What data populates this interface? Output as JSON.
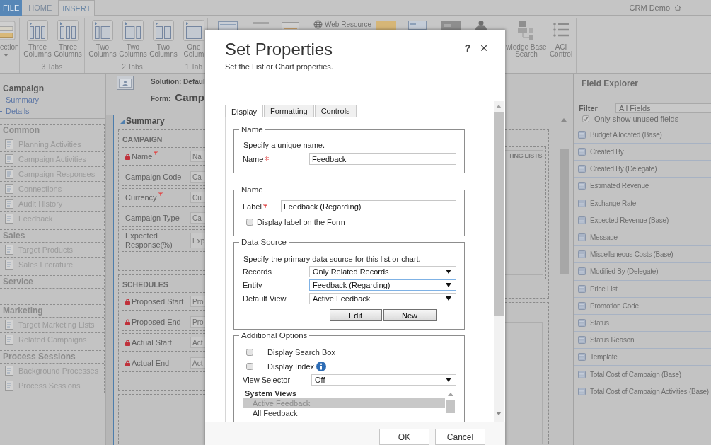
{
  "ribbon_tabs": [
    {
      "label": "FILE",
      "kind": "file",
      "selected": false
    },
    {
      "label": "HOME",
      "kind": "tab",
      "selected": false
    },
    {
      "label": "INSERT",
      "kind": "tab",
      "selected": true
    }
  ],
  "user_name": "CRM Demo",
  "ribbon": {
    "groups": [
      {
        "buttons": [
          {
            "kind": "section",
            "label": "ection"
          }
        ]
      },
      {
        "label": "3 Tabs",
        "buttons": [
          {
            "kind": "three-columns",
            "label": "Three Columns"
          },
          {
            "kind": "three-columns",
            "label": "Three Columns"
          }
        ]
      },
      {
        "label": "2 Tabs",
        "buttons": [
          {
            "kind": "narrow-wide",
            "label": "Two Columns"
          },
          {
            "kind": "wide-narrow",
            "label": "Two Columns"
          },
          {
            "kind": "two-equal",
            "label": "Two Columns"
          }
        ]
      },
      {
        "label": "1 Tab",
        "buttons": [
          {
            "kind": "one-column",
            "label": "One Colum"
          }
        ]
      },
      {
        "buttons": [
          {
            "kind": "window"
          },
          {
            "kind": "bar"
          },
          {
            "kind": "frame"
          },
          {
            "kind": "web-resource",
            "label": "Web Resource"
          },
          {
            "kind": "orange-tile"
          },
          {
            "kind": "blue-window"
          },
          {
            "kind": "dark-tile"
          },
          {
            "kind": "person"
          },
          {
            "kind": "knowledge-base",
            "label": "wledge Base Search"
          },
          {
            "kind": "list",
            "label": "ACI Control"
          }
        ]
      }
    ]
  },
  "left_nav": {
    "title": "Campaign",
    "links": [
      "Summary",
      "Details"
    ],
    "groups": [
      {
        "title": "Common",
        "items": [
          "Planning Activities",
          "Campaign Activities",
          "Campaign Responses",
          "Connections",
          "Audit History",
          "Feedback"
        ]
      },
      {
        "title": "Sales",
        "items": [
          "Target Products",
          "Sales Literature"
        ]
      },
      {
        "title": "Service"
      },
      {
        "title": "Marketing",
        "items": [
          "Target Marketing Lists",
          "Related Campaigns"
        ]
      },
      {
        "title": "Process Sessions",
        "items": [
          "Background Processes",
          "Process Sessions"
        ]
      }
    ]
  },
  "form": {
    "solution": "Solution: Defaul",
    "form_label": "Form:",
    "form_name": "Camp",
    "tab": {
      "title": "Summary",
      "expanded": true
    },
    "sections": [
      {
        "title": "CAMPAIGN",
        "fields": [
          {
            "label": "Name",
            "locked": true,
            "required": true,
            "placeholder": "Na"
          },
          {
            "label": "Campaign Code",
            "locked": false,
            "required": false,
            "placeholder": "Ca"
          },
          {
            "label": "Currency",
            "locked": false,
            "required": true,
            "placeholder": "Cu"
          },
          {
            "label": "Campaign Type",
            "locked": false,
            "required": false,
            "placeholder": "Ca"
          },
          {
            "label": "Expected Response(%)",
            "locked": false,
            "required": false,
            "placeholder": "Exp"
          }
        ]
      },
      {
        "title": "SCHEDULES",
        "fields": [
          {
            "label": "Proposed Start",
            "locked": true,
            "required": false,
            "placeholder": "Pro"
          },
          {
            "label": "Proposed End",
            "locked": true,
            "required": false,
            "placeholder": "Pro"
          },
          {
            "label": "Actual Start",
            "locked": true,
            "required": false,
            "placeholder": "Act"
          },
          {
            "label": "Actual End",
            "locked": true,
            "required": false,
            "placeholder": "Act"
          }
        ]
      }
    ],
    "side_section": {
      "title": "TING LISTS"
    }
  },
  "field_explorer": {
    "title": "Field Explorer",
    "filter_label": "Filter",
    "filter_value": "All Fields",
    "unused_only": {
      "label": "Only show unused fields",
      "checked": true
    },
    "fields": [
      "Budget Allocated (Base)",
      "Created By",
      "Created By (Delegate)",
      "Estimated Revenue",
      "Exchange Rate",
      "Expected Revenue (Base)",
      "Message",
      "Miscellaneous Costs (Base)",
      "Modified By (Delegate)",
      "Price List",
      "Promotion Code",
      "Status",
      "Status Reason",
      "Template",
      "Total Cost of Campaign (Base)",
      "Total Cost of Campaign Activities (Base)"
    ]
  },
  "dialog": {
    "title": "Set Properties",
    "help": "?",
    "close": "×",
    "subtitle": "Set the List or Chart properties.",
    "tabs": [
      {
        "label": "Display",
        "selected": true
      },
      {
        "label": "Formatting",
        "selected": false
      },
      {
        "label": "Controls",
        "selected": false
      }
    ],
    "sections": [
      {
        "legend": "Name",
        "description": "Specify a unique name.",
        "rows": [
          {
            "kind": "text",
            "label": "Name",
            "required": true,
            "value": "Feedback"
          }
        ]
      },
      {
        "legend": "Name",
        "rows": [
          {
            "kind": "text",
            "label": "Label",
            "required": true,
            "value": "Feedback (Regarding)"
          },
          {
            "kind": "checkbox",
            "label": "Display label on the Form",
            "checked": false,
            "info": false
          }
        ]
      },
      {
        "legend": "Data Source",
        "description": "Specify the primary data source for this list or chart.",
        "rows": [
          {
            "kind": "select",
            "label": "Records",
            "value": "Only Related Records",
            "focused": false
          },
          {
            "kind": "select",
            "label": "Entity",
            "value": "Feedback (Regarding)",
            "focused": true
          },
          {
            "kind": "select",
            "label": "Default View",
            "value": "Active Feedback",
            "focused": false
          },
          {
            "kind": "buttons",
            "buttons": [
              "Edit",
              "New"
            ]
          }
        ]
      },
      {
        "legend": "Additional Options",
        "rows": [
          {
            "kind": "checkbox",
            "label": "Display Search Box",
            "checked": false,
            "info": false
          },
          {
            "kind": "checkbox",
            "label": "Display Index",
            "checked": false,
            "info": true
          },
          {
            "kind": "select",
            "label": "View Selector",
            "value": "Off",
            "focused": false
          },
          {
            "kind": "listbox",
            "header": "System Views",
            "items": [
              {
                "label": "Active Feedback",
                "selected": true
              },
              {
                "label": "All Feedback",
                "selected": false
              }
            ]
          }
        ]
      }
    ],
    "footer_buttons": [
      "OK",
      "Cancel"
    ]
  }
}
